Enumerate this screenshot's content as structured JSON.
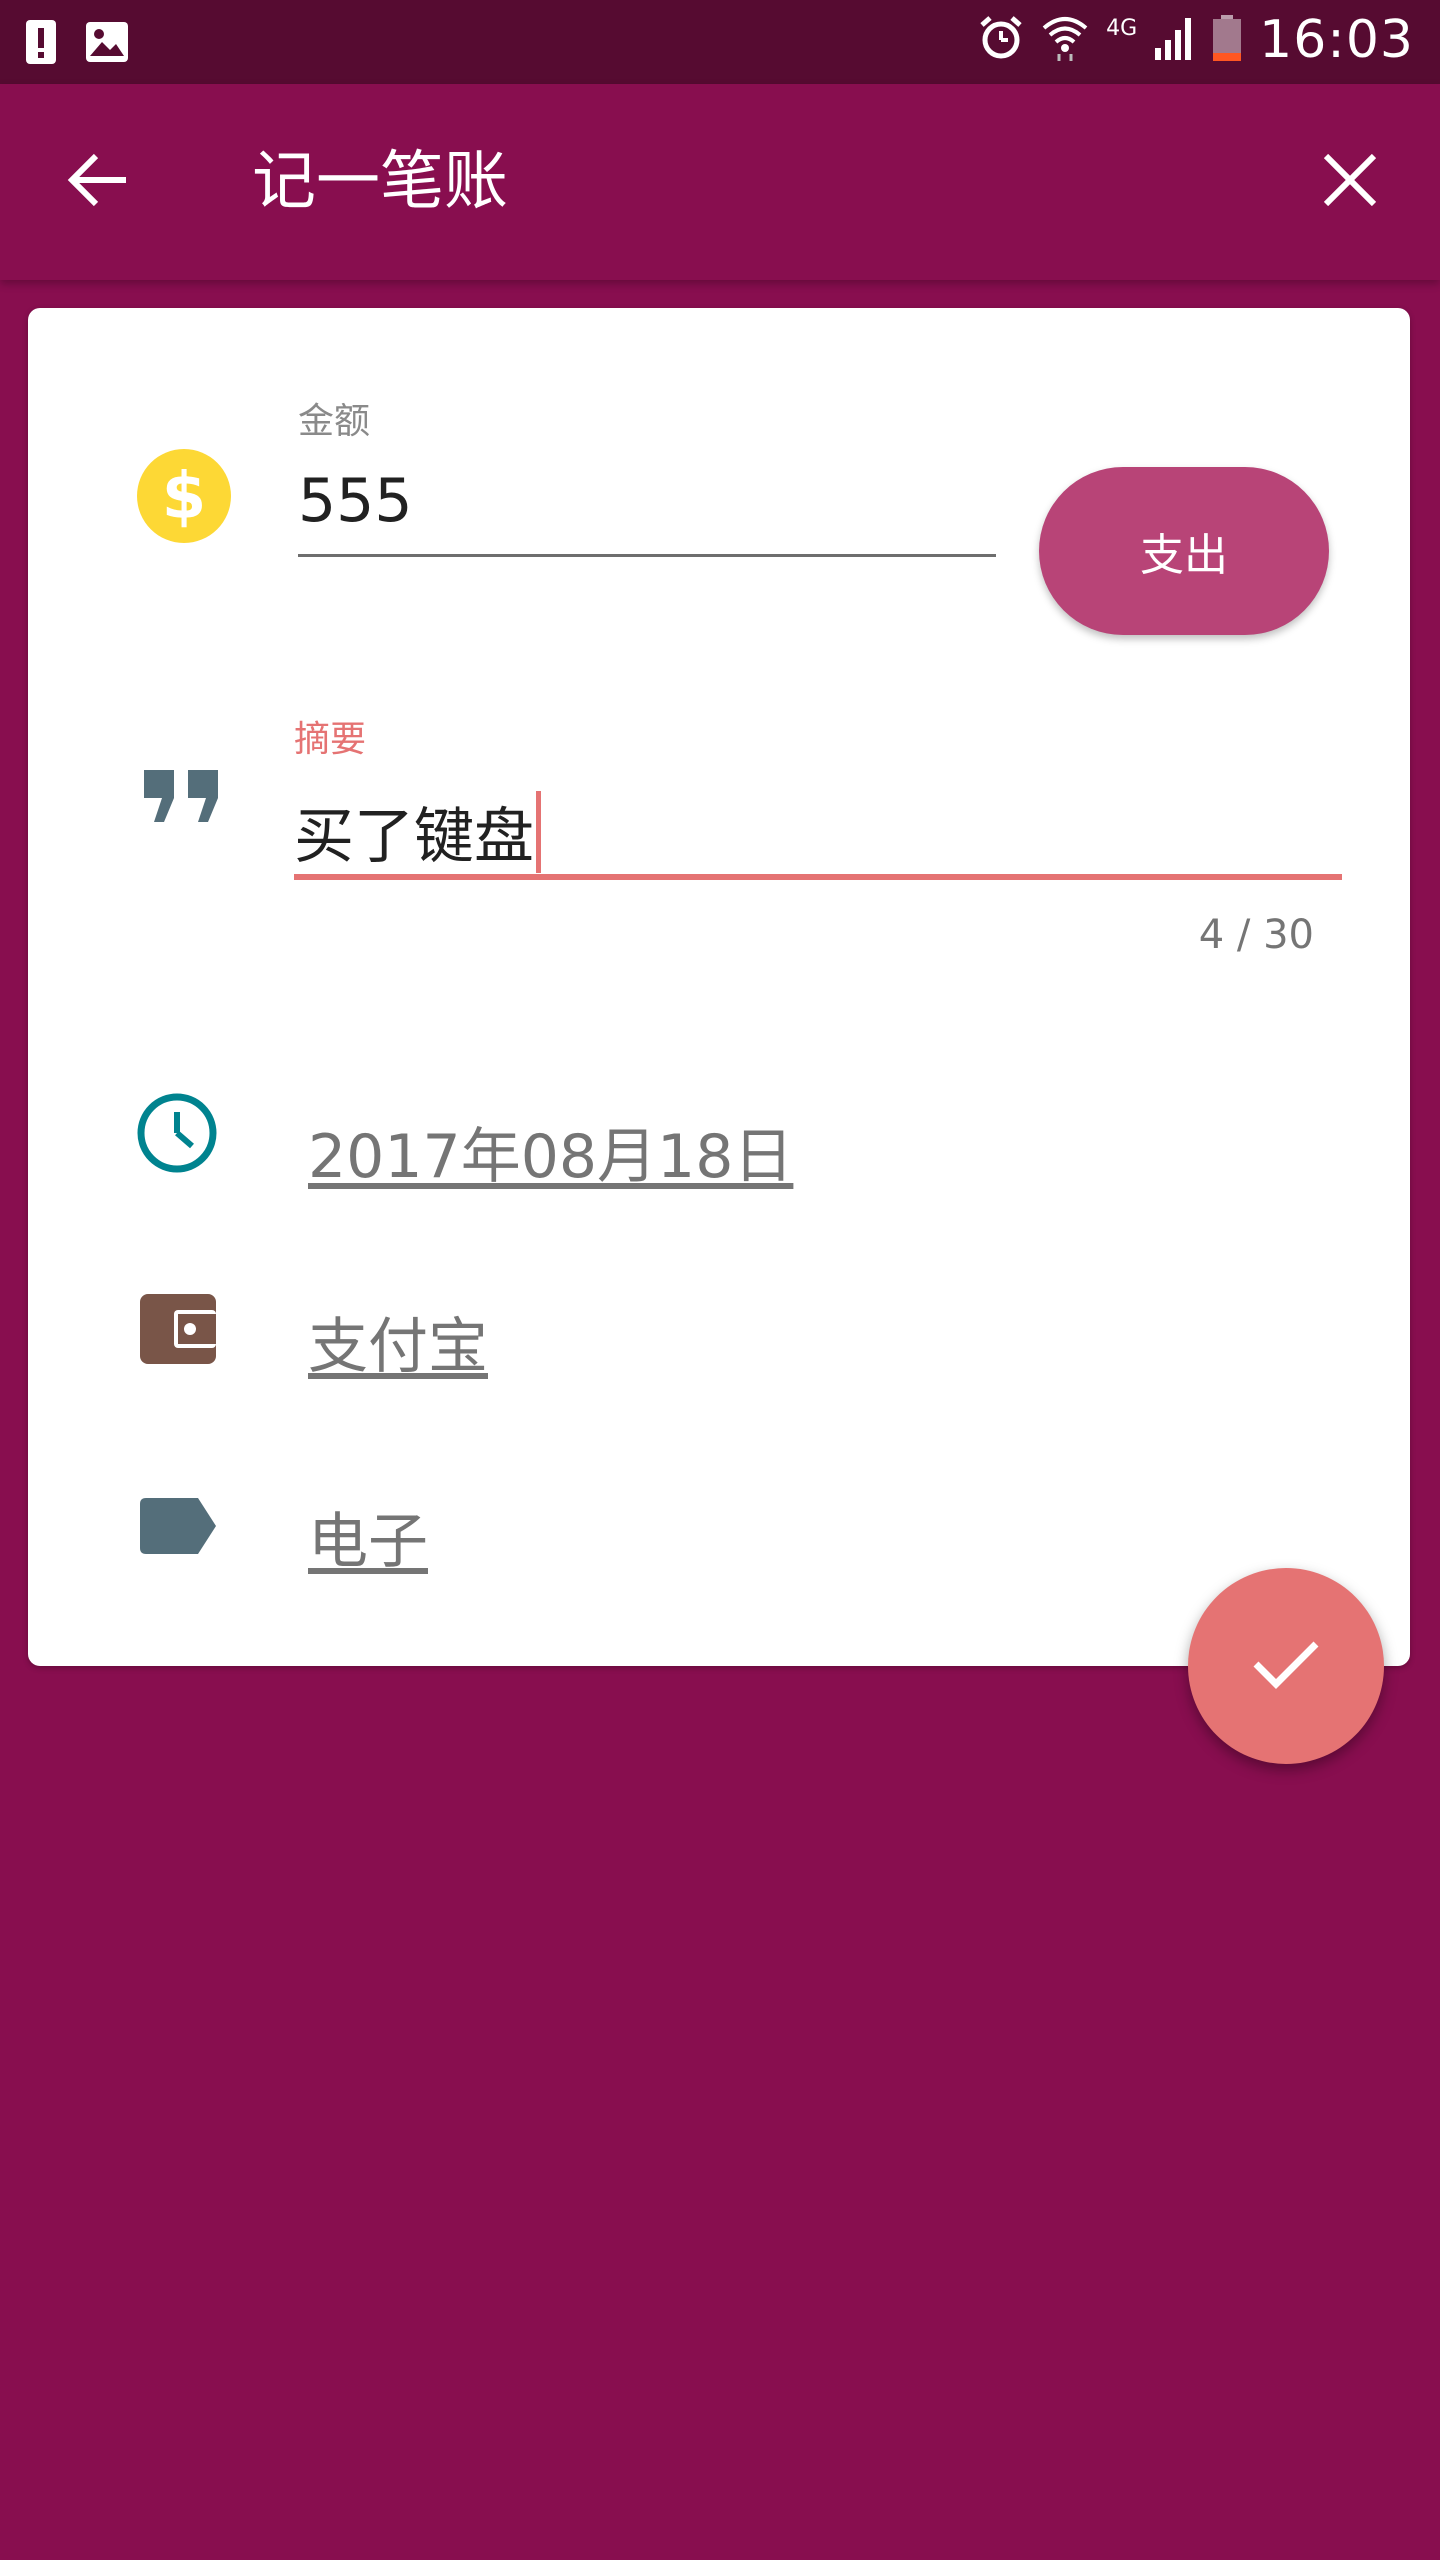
{
  "status_bar": {
    "time": "16:03",
    "network_label": "4G",
    "icons": [
      "alert-icon",
      "image-icon",
      "alarm-icon",
      "wifi-icon",
      "signal-icon",
      "battery-icon"
    ]
  },
  "app_bar": {
    "title": "记一笔账",
    "back_icon": "arrow-back-icon",
    "close_icon": "close-icon"
  },
  "form": {
    "amount": {
      "label": "金额",
      "value": "555",
      "icon": "dollar-coin-icon"
    },
    "type_button": {
      "label": "支出"
    },
    "summary": {
      "label": "摘要",
      "value": "买了键盘",
      "counter": "4 / 30",
      "icon": "quote-icon"
    },
    "date": {
      "value": "2017年08月18日",
      "icon": "clock-icon"
    },
    "account": {
      "value": "支付宝",
      "icon": "wallet-icon"
    },
    "category": {
      "value": "电子",
      "icon": "label-tag-icon"
    }
  },
  "fab": {
    "icon": "check-icon"
  },
  "colors": {
    "primary": "#880e4f",
    "status_bar": "#560b31",
    "accent": "#e57373",
    "type_button": "#b84477",
    "coin": "#fdd835",
    "clock": "#00838f",
    "wallet": "#795548",
    "tag": "#546e7a",
    "quote": "#546e7a"
  }
}
